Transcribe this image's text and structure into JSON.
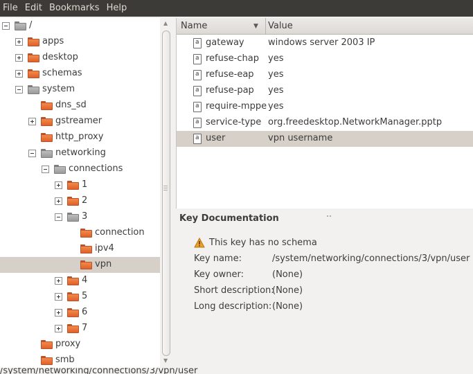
{
  "menubar": {
    "items": [
      "File",
      "Edit",
      "Bookmarks",
      "Help"
    ]
  },
  "tree": {
    "items": [
      {
        "label": "/",
        "expander": "minus",
        "folder": "gray",
        "selected": false
      },
      {
        "label": "apps",
        "expander": "plus",
        "folder": "orange",
        "selected": false
      },
      {
        "label": "desktop",
        "expander": "plus",
        "folder": "orange",
        "selected": false
      },
      {
        "label": "schemas",
        "expander": "plus",
        "folder": "orange",
        "selected": false
      },
      {
        "label": "system",
        "expander": "minus",
        "folder": "gray",
        "selected": false
      },
      {
        "label": "dns_sd",
        "expander": "none",
        "folder": "orange",
        "selected": false
      },
      {
        "label": "gstreamer",
        "expander": "plus",
        "folder": "orange",
        "selected": false
      },
      {
        "label": "http_proxy",
        "expander": "none",
        "folder": "orange",
        "selected": false
      },
      {
        "label": "networking",
        "expander": "minus",
        "folder": "gray",
        "selected": false
      },
      {
        "label": "connections",
        "expander": "minus",
        "folder": "gray",
        "selected": false
      },
      {
        "label": "1",
        "expander": "plus",
        "folder": "orange",
        "selected": false
      },
      {
        "label": "2",
        "expander": "plus",
        "folder": "orange",
        "selected": false
      },
      {
        "label": "3",
        "expander": "minus",
        "folder": "gray",
        "selected": false
      },
      {
        "label": "connection",
        "expander": "none",
        "folder": "orange",
        "selected": false
      },
      {
        "label": "ipv4",
        "expander": "none",
        "folder": "orange",
        "selected": false
      },
      {
        "label": "vpn",
        "expander": "none",
        "folder": "orange",
        "selected": true
      },
      {
        "label": "4",
        "expander": "plus",
        "folder": "orange",
        "selected": false
      },
      {
        "label": "5",
        "expander": "plus",
        "folder": "orange",
        "selected": false
      },
      {
        "label": "6",
        "expander": "plus",
        "folder": "orange",
        "selected": false
      },
      {
        "label": "7",
        "expander": "plus",
        "folder": "orange",
        "selected": false
      },
      {
        "label": "proxy",
        "expander": "none",
        "folder": "orange",
        "selected": false
      },
      {
        "label": "smb",
        "expander": "none",
        "folder": "orange",
        "selected": false
      }
    ]
  },
  "list": {
    "columns": {
      "name": "Name",
      "value": "Value"
    },
    "rows": [
      {
        "name": "gateway",
        "value": "windows server 2003 IP",
        "selected": false
      },
      {
        "name": "refuse-chap",
        "value": "yes",
        "selected": false
      },
      {
        "name": "refuse-eap",
        "value": "yes",
        "selected": false
      },
      {
        "name": "refuse-pap",
        "value": "yes",
        "selected": false
      },
      {
        "name": "require-mppe",
        "value": "yes",
        "selected": false
      },
      {
        "name": "service-type",
        "value": "org.freedesktop.NetworkManager.pptp",
        "selected": false
      },
      {
        "name": "user",
        "value": "vpn username",
        "selected": true
      }
    ]
  },
  "documentation": {
    "title": "Key Documentation",
    "warning": "This key has no schema",
    "fields": [
      {
        "label": "Key name:",
        "value": "/system/networking/connections/3/vpn/user"
      },
      {
        "label": "Key owner:",
        "value": "(None)"
      },
      {
        "label": "Short description:",
        "value": "(None)"
      },
      {
        "label": "Long description:",
        "value": "(None)"
      }
    ]
  },
  "statusbar": {
    "path": "/system/networking/connections/3/vpn/user"
  },
  "colors": {
    "menubar_bg": "#3c3b37",
    "selection": "#d6d0c8",
    "folder_orange": "#f28a4a",
    "warning": "#f0a020"
  },
  "icons": {
    "folder": "folder-icon",
    "key": "key-document-icon",
    "warning": "warning-icon"
  }
}
